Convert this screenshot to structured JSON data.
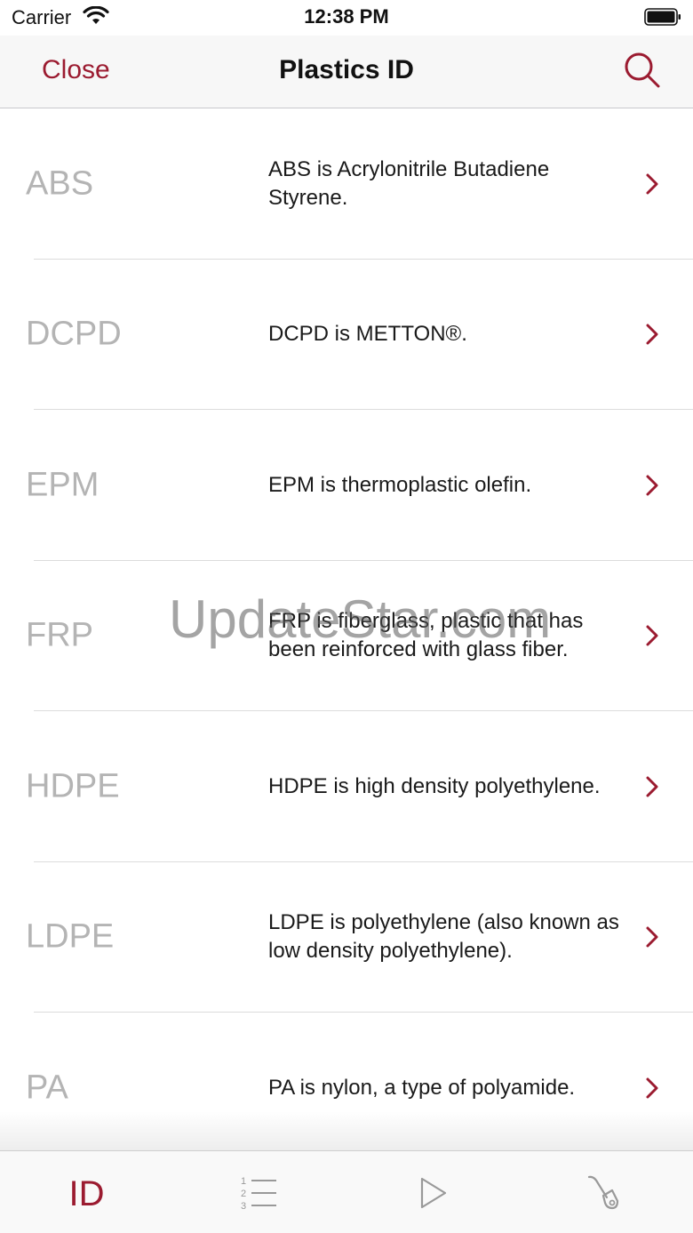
{
  "status_bar": {
    "carrier": "Carrier",
    "time": "12:38 PM"
  },
  "nav": {
    "close_label": "Close",
    "title": "Plastics ID",
    "search_icon": "search-icon"
  },
  "colors": {
    "accent": "#9b1b30",
    "code_gray": "#b4b4b4",
    "separator": "#dcdcdc"
  },
  "items": [
    {
      "code": "ABS",
      "description": "ABS is Acrylonitrile Butadiene Styrene."
    },
    {
      "code": "DCPD",
      "description": "DCPD is METTON®."
    },
    {
      "code": "EPM",
      "description": "EPM is thermoplastic olefin."
    },
    {
      "code": "FRP",
      "description": "FRP is fiberglass, plastic that has been reinforced with glass fiber."
    },
    {
      "code": "HDPE",
      "description": "HDPE is high density polyethylene."
    },
    {
      "code": "LDPE",
      "description": "LDPE is polyethylene (also known as low density polyethylene)."
    },
    {
      "code": "PA",
      "description": "PA is nylon, a type of polyamide."
    }
  ],
  "watermark": "UpdateStar.com",
  "tabs": [
    {
      "label": "ID",
      "icon": "id-tab",
      "active": true
    },
    {
      "label": "",
      "icon": "numbered-list-icon",
      "active": false
    },
    {
      "label": "",
      "icon": "play-icon",
      "active": false
    },
    {
      "label": "",
      "icon": "welding-torch-icon",
      "active": false
    }
  ]
}
